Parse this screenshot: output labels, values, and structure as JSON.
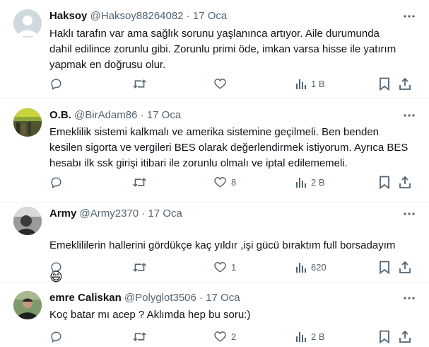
{
  "colors": {
    "text": "#0f1419",
    "muted": "#536471",
    "divider": "#eff3f4"
  },
  "tweets": [
    {
      "name": "Haksoy",
      "handle": "@Haksoy88264082",
      "dot": "·",
      "time": "17 Oca",
      "text": "Haklı tarafın var ama sağlık sorunu yaşlanınca artıyor. Aile durumunda\ndahil edilince zorunlu gibi. Zorunlu primi öde, imkan varsa hisse ile yatırım\nyapmak en doğrusu olur.",
      "emoji": "",
      "likes": "",
      "views": "1 B"
    },
    {
      "name": "O.B.",
      "handle": "@BirAdam86",
      "dot": "·",
      "time": "17 Oca",
      "text": "Emeklilik sistemi kalkmalı ve amerika sistemine geçilmeli. Ben benden\nkesilen sigorta ve vergileri BES olarak değerlendirmek istiyorum. Ayrıca BES\nhesabı ilk ssk girişi itibari ile zorunlu olmalı ve iptal edilememeli.",
      "emoji": "",
      "likes": "8",
      "views": "2 B"
    },
    {
      "name": "Army",
      "handle": "@Army2370",
      "dot": "·",
      "time": "17 Oca",
      "text": "Emeklililerin hallerini gördükçe kaç yıldır ,işi gücü bıraktım full borsadayım",
      "emoji": "😄",
      "likes": "1",
      "views": "620"
    },
    {
      "name": "emre Caliskan",
      "handle": "@Polyglot3506",
      "dot": "·",
      "time": "17 Oca",
      "text": "Koç batar mı acep ? Aklımda hep bu soru:)",
      "emoji": "",
      "likes": "2",
      "views": "2 B"
    }
  ]
}
